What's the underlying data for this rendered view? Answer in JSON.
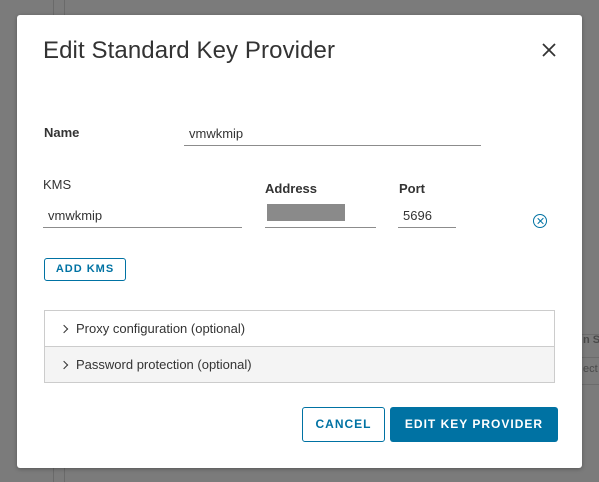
{
  "background": {
    "fragment_1": "n S",
    "fragment_2": "ect"
  },
  "dialog": {
    "title": "Edit Standard Key Provider",
    "close_icon": "close-icon",
    "name_label": "Name",
    "name_value": "vmwkmip",
    "kms_label": "KMS",
    "address_label": "Address",
    "port_label": "Port",
    "kms_value": "vmwkmip",
    "address_value": "",
    "port_value": "5696",
    "remove_kms_icon": "remove-circle-icon",
    "add_kms_label": "ADD KMS",
    "sections": [
      {
        "label": "Proxy configuration (optional)",
        "icon": "chevron-right-icon"
      },
      {
        "label": "Password protection (optional)",
        "icon": "chevron-right-icon"
      }
    ],
    "cancel_label": "CANCEL",
    "submit_label": "EDIT KEY PROVIDER"
  },
  "colors": {
    "primary": "#0072a3",
    "overlay": "#7b7b7b"
  }
}
